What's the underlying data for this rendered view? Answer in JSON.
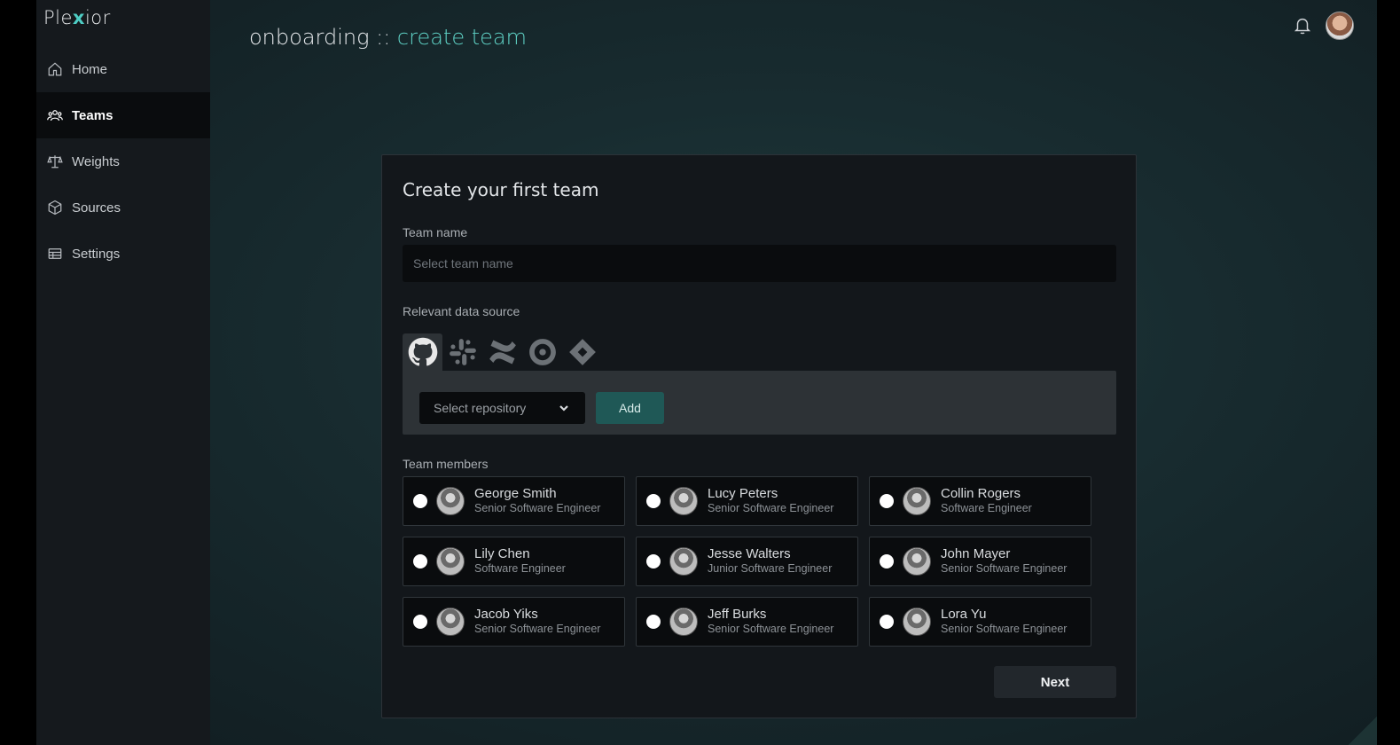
{
  "app": {
    "logo_prefix": "Ple",
    "logo_x": "x",
    "logo_suffix": "ior"
  },
  "sidebar": {
    "items": [
      {
        "label": "Home",
        "icon": "home-icon",
        "active": false
      },
      {
        "label": "Teams",
        "icon": "users-icon",
        "active": true
      },
      {
        "label": "Weights",
        "icon": "scale-icon",
        "active": false
      },
      {
        "label": "Sources",
        "icon": "cube-icon",
        "active": false
      },
      {
        "label": "Settings",
        "icon": "table-icon",
        "active": false
      }
    ]
  },
  "header": {
    "title_prefix": "onboarding :: ",
    "title_accent": "create team",
    "notification_icon": "bell-icon",
    "avatar": "profile-avatar"
  },
  "form": {
    "title": "Create your first team",
    "team_name_label": "Team name",
    "team_name_placeholder": "Select team name",
    "team_name_value": "",
    "data_source_label": "Relevant data source",
    "sources": [
      {
        "icon": "github-icon",
        "active": true
      },
      {
        "icon": "slack-icon",
        "active": false
      },
      {
        "icon": "confluence-icon",
        "active": false
      },
      {
        "icon": "circleci-icon",
        "active": false
      },
      {
        "icon": "jira-icon",
        "active": false
      }
    ],
    "repo_placeholder": "Select repository",
    "add_label": "Add",
    "members_label": "Team members",
    "members": [
      {
        "name": "George Smith",
        "role": "Senior Software Engineer"
      },
      {
        "name": "Lucy Peters",
        "role": "Senior Software Engineer"
      },
      {
        "name": "Collin Rogers",
        "role": "Software Engineer"
      },
      {
        "name": "Lily Chen",
        "role": "Software Engineer"
      },
      {
        "name": "Jesse Walters",
        "role": "Junior Software Engineer"
      },
      {
        "name": "John Mayer",
        "role": "Senior Software Engineer"
      },
      {
        "name": "Jacob Yiks",
        "role": "Senior Software Engineer"
      },
      {
        "name": "Jeff Burks",
        "role": "Senior Software Engineer"
      },
      {
        "name": "Lora Yu",
        "role": "Senior Software Engineer"
      }
    ],
    "next_label": "Next"
  },
  "colors": {
    "accent": "#5fd2c6",
    "add_button": "#1f5856",
    "sidebar_bg": "#15191d",
    "card_bg": "#13171b"
  }
}
